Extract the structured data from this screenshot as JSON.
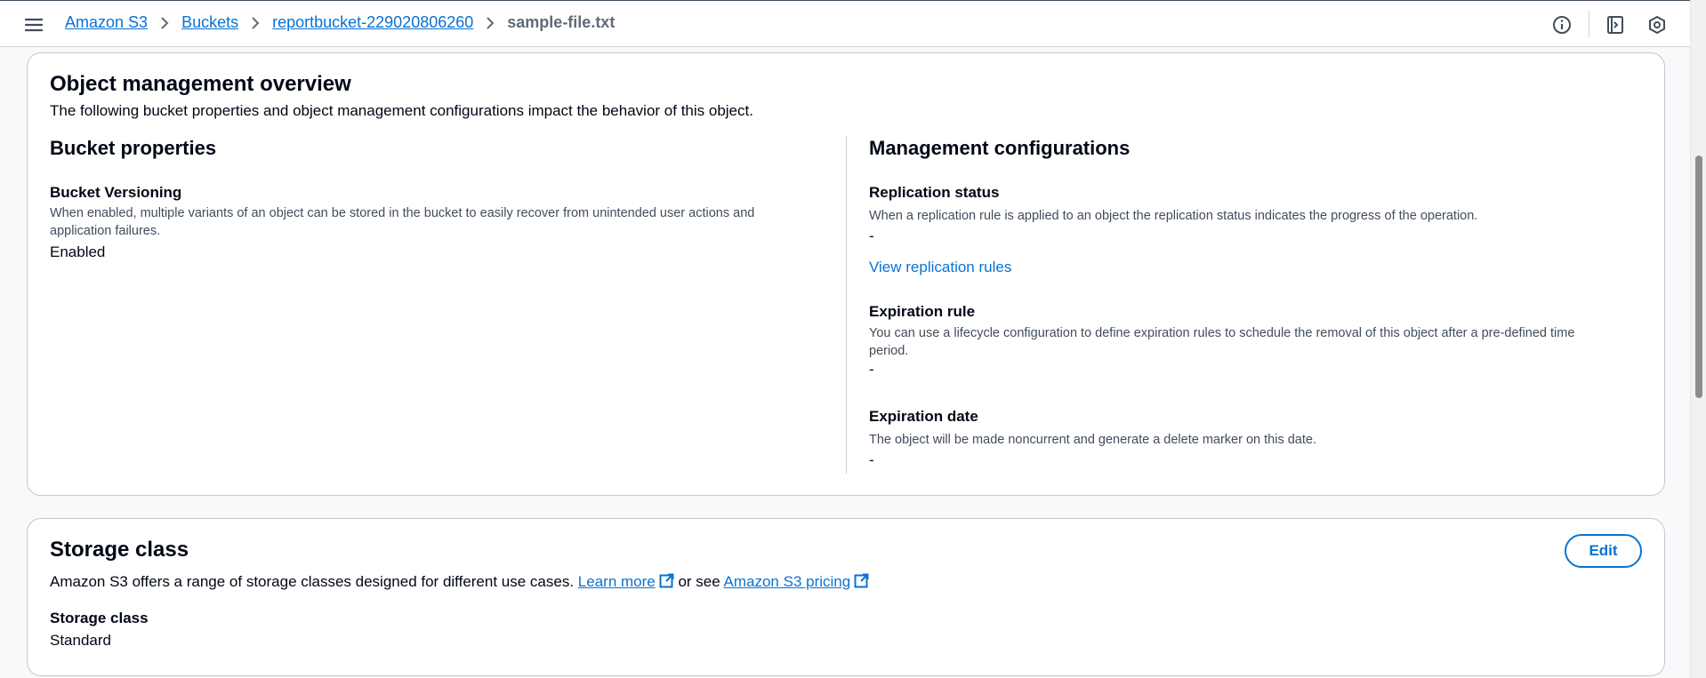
{
  "breadcrumb": {
    "items": [
      "Amazon S3",
      "Buckets",
      "reportbucket-229020806260"
    ],
    "current": "sample-file.txt"
  },
  "overview": {
    "title": "Object management overview",
    "description": "The following bucket properties and object management configurations impact the behavior of this object.",
    "bucket_properties": {
      "heading": "Bucket properties",
      "versioning_label": "Bucket Versioning",
      "versioning_desc_line1": "When enabled, multiple variants of an object can be stored in the bucket to easily recover from unintended user actions and",
      "versioning_desc_line2": "application failures.",
      "versioning_value": "Enabled"
    },
    "management": {
      "heading": "Management configurations",
      "replication_label": "Replication status",
      "replication_desc": "When a replication rule is applied to an object the replication status indicates the progress of the operation.",
      "replication_value": "-",
      "replication_link": "View replication rules",
      "expiration_rule_label": "Expiration rule",
      "expiration_rule_desc_line1": "You can use a lifecycle configuration to define expiration rules to schedule the removal of this object after a pre-defined time",
      "expiration_rule_desc_line2": "period.",
      "expiration_rule_value": "-",
      "expiration_date_label": "Expiration date",
      "expiration_date_desc": "The object will be made noncurrent and generate a delete marker on this date.",
      "expiration_date_value": "-"
    }
  },
  "storage": {
    "title": "Storage class",
    "edit_label": "Edit",
    "desc_prefix": "Amazon S3 offers a range of storage classes designed for different use cases.",
    "learn_more": "Learn more",
    "or_see": "or see",
    "pricing_link": "Amazon S3 pricing",
    "class_label": "Storage class",
    "class_value": "Standard"
  },
  "colors": {
    "link": "#0972d3",
    "text": "#000716",
    "secondary_text": "#414d5c"
  },
  "icons": [
    "menu-icon",
    "chevron-right-icon",
    "info-icon",
    "panel-toggle-icon",
    "settings-hexagon-icon",
    "external-link-icon"
  ]
}
